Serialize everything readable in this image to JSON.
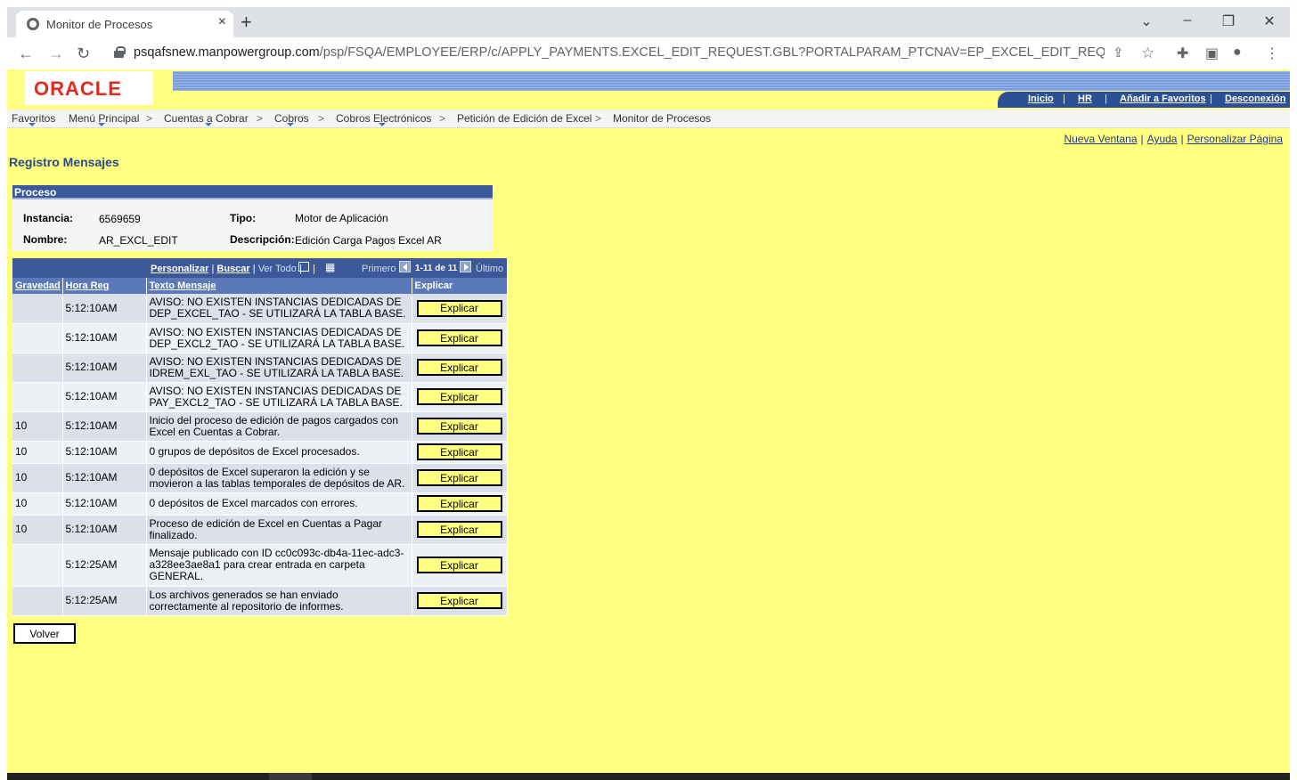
{
  "browser": {
    "tab_title": "Monitor de Procesos",
    "tab_close": "×",
    "new_tab": "+",
    "url_domain": "psqafsnew.manpowergroup.com",
    "url_path": "/psp/FSQA/EMPLOYEE/ERP/c/APPLY_PAYMENTS.EXCEL_EDIT_REQUEST.GBL?PORTALPARAM_PTCNAV=EP_EXCEL_EDIT_REQUEST_GBL&EOPP.SC..."
  },
  "header": {
    "logo": "ORACLE",
    "links": [
      "Inicio",
      "HR",
      "Añadir a Favoritos",
      "Desconexión"
    ]
  },
  "nav": {
    "items": [
      "Favoritos",
      "Menú Principal",
      "Cuentas a Cobrar",
      "Cobros",
      "Cobros Electrónicos",
      "Petición de Edición de Excel",
      "Monitor de Procesos"
    ]
  },
  "toplinks": [
    "Nueva Ventana",
    "Ayuda",
    "Personalizar Página"
  ],
  "page_title": "Registro Mensajes",
  "proceso": {
    "header": "Proceso",
    "instancia_label": "Instancia:",
    "instancia": "6569659",
    "tipo_label": "Tipo:",
    "tipo": "Motor de Aplicación",
    "nombre_label": "Nombre:",
    "nombre": "AR_EXCL_EDIT",
    "descripcion_label": "Descripción:",
    "descripcion": "Edición Carga Pagos Excel AR"
  },
  "grid": {
    "personalizar": "Personalizar",
    "buscar": "Buscar",
    "ver_todo": "Ver Todo",
    "primero": "Primero",
    "range": "1-11 de 11",
    "ultimo": "Último",
    "columns": [
      "Gravedad",
      "Hora Reg",
      "Texto Mensaje",
      "Explicar"
    ],
    "button_label": "Explicar",
    "rows": [
      {
        "gravedad": "",
        "hora": "5:12:10AM",
        "texto": "AVISO: NO EXISTEN INSTANCIAS DEDICADAS DE DEP_EXCEL_TAO - SE UTILIZARÁ LA TABLA BASE."
      },
      {
        "gravedad": "",
        "hora": "5:12:10AM",
        "texto": "AVISO: NO EXISTEN INSTANCIAS DEDICADAS DE DEP_EXCL2_TAO - SE UTILIZARÁ LA TABLA BASE."
      },
      {
        "gravedad": "",
        "hora": "5:12:10AM",
        "texto": "AVISO: NO EXISTEN INSTANCIAS DEDICADAS DE IDREM_EXL_TAO - SE UTILIZARÁ LA TABLA BASE."
      },
      {
        "gravedad": "",
        "hora": "5:12:10AM",
        "texto": "AVISO: NO EXISTEN INSTANCIAS DEDICADAS DE PAY_EXCL2_TAO - SE UTILIZARÁ LA TABLA BASE."
      },
      {
        "gravedad": "10",
        "hora": "5:12:10AM",
        "texto": "Inicio del proceso de edición de pagos cargados con Excel en Cuentas a Cobrar."
      },
      {
        "gravedad": "10",
        "hora": "5:12:10AM",
        "texto": "0 grupos de depósitos de Excel procesados."
      },
      {
        "gravedad": "10",
        "hora": "5:12:10AM",
        "texto": "0 depósitos de Excel superaron la edición y se movieron a las tablas temporales de depósitos de AR."
      },
      {
        "gravedad": "10",
        "hora": "5:12:10AM",
        "texto": "0 depósitos de Excel marcados con errores."
      },
      {
        "gravedad": "10",
        "hora": "5:12:10AM",
        "texto": "Proceso de edición de Excel en Cuentas a Pagar finalizado."
      },
      {
        "gravedad": "",
        "hora": "5:12:25AM",
        "texto": "Mensaje publicado con ID cc0c093c-db4a-11ec-adc3-a328ee3ae8a1 para crear entrada en carpeta GENERAL."
      },
      {
        "gravedad": "",
        "hora": "5:12:25AM",
        "texto": "Los archivos generados se han enviado correctamente al repositorio de informes."
      }
    ]
  },
  "volver": "Volver",
  "colors": {
    "page_bg": "#ffff80",
    "grid_header": "#3b5998",
    "link": "#1f3b86",
    "oracle_red": "#e22a1f"
  }
}
